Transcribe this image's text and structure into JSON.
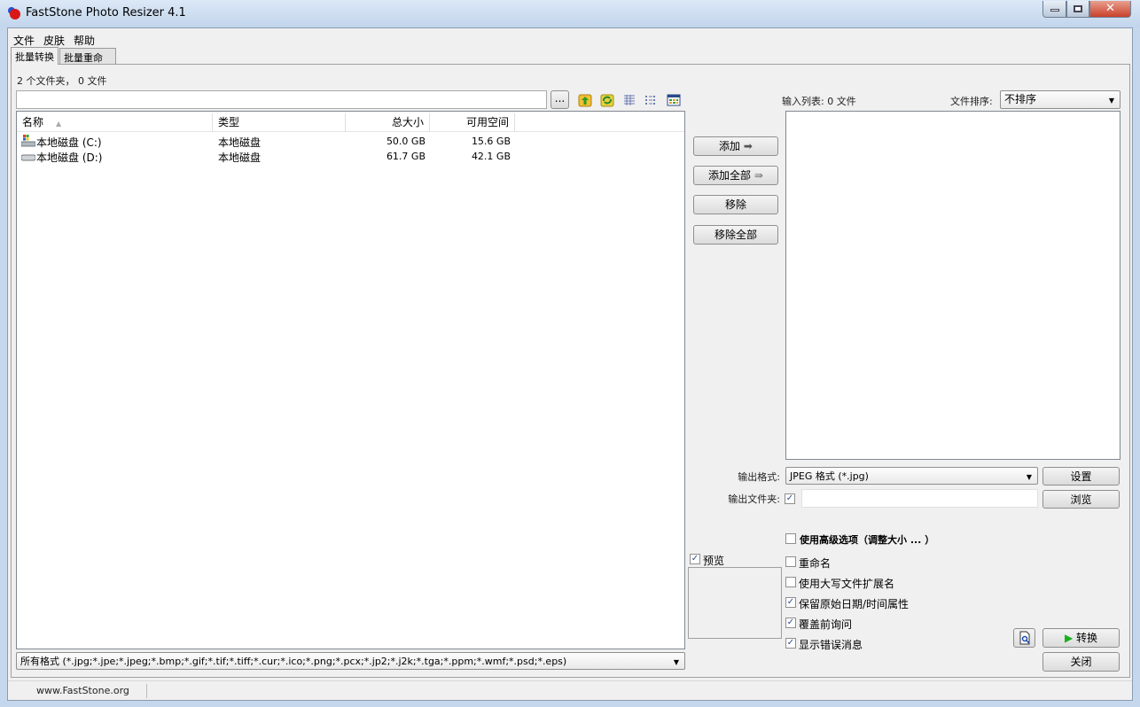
{
  "window": {
    "title": "FastStone Photo Resizer 4.1"
  },
  "menu": [
    "文件",
    "皮肤",
    "帮助"
  ],
  "tabs": [
    {
      "label": "批量转换",
      "active": true
    },
    {
      "label": "批量重命名",
      "active": false
    }
  ],
  "browser": {
    "count_text": "2 个文件夹， 0 文件",
    "path_value": "",
    "browse_label": "...",
    "columns": [
      "名称",
      "类型",
      "总大小",
      "可用空间"
    ],
    "rows": [
      {
        "name": "本地磁盘 (C:)",
        "type": "本地磁盘",
        "total": "50.0 GB",
        "free": "15.6 GB",
        "icon": "system-drive-icon"
      },
      {
        "name": "本地磁盘 (D:)",
        "type": "本地磁盘",
        "total": "61.7 GB",
        "free": "42.1 GB",
        "icon": "drive-icon"
      }
    ],
    "filter": "所有格式 (*.jpg;*.jpe;*.jpeg;*.bmp;*.gif;*.tif;*.tiff;*.cur;*.ico;*.png;*.pcx;*.jp2;*.j2k;*.tga;*.ppm;*.wmf;*.psd;*.eps)"
  },
  "actions": {
    "add": "添加",
    "add_all": "添加全部",
    "remove": "移除",
    "remove_all": "移除全部"
  },
  "input_list": {
    "label": "输入列表: 0 文件",
    "sort_label": "文件排序:",
    "sort_value": "不排序"
  },
  "output": {
    "format_label": "输出格式:",
    "format_value": "JPEG 格式 (*.jpg)",
    "settings": "设置",
    "folder_label": "输出文件夹:",
    "folder_checked": true,
    "folder_value": "",
    "browse": "浏览"
  },
  "options": [
    {
      "label": "使用高级选项（调整大小 ... ）",
      "checked": false
    },
    {
      "label": "重命名",
      "checked": false
    },
    {
      "label": "使用大写文件扩展名",
      "checked": false
    },
    {
      "label": "保留原始日期/时间属性",
      "checked": true
    },
    {
      "label": "覆盖前询问",
      "checked": true
    },
    {
      "label": "显示错误消息",
      "checked": true
    }
  ],
  "preview": {
    "label": "预览",
    "checked": true
  },
  "buttons": {
    "convert": "转换",
    "close": "关闭"
  },
  "status": {
    "website": "www.FastStone.org"
  }
}
